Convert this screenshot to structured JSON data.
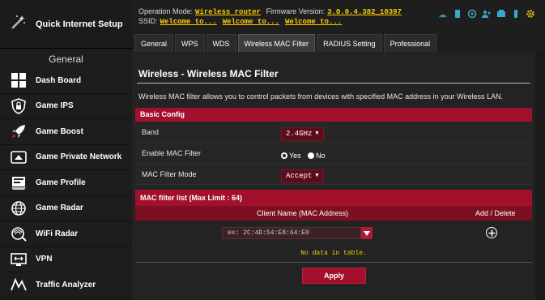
{
  "colors": {
    "accent": "#a2102b",
    "accent_dark": "#7c0f22",
    "value_yellow": "#ffcc00",
    "panel_bg": "#232323"
  },
  "sidebar": {
    "quick_setup": {
      "label": "Quick Internet Setup",
      "icon": "wizard-icon"
    },
    "section_label": "General",
    "items": [
      {
        "label": "Dash Board",
        "icon": "dashboard-icon"
      },
      {
        "label": "Game IPS",
        "icon": "lock-shield-icon"
      },
      {
        "label": "Game Boost",
        "icon": "rocket-icon"
      },
      {
        "label": "Game Private Network",
        "icon": "private-network-icon"
      },
      {
        "label": "Game Profile",
        "icon": "profile-icon"
      },
      {
        "label": "Game Radar",
        "icon": "radar-globe-icon"
      },
      {
        "label": "WiFi Radar",
        "icon": "wifi-radar-icon"
      },
      {
        "label": "VPN",
        "icon": "vpn-icon"
      },
      {
        "label": "Traffic Analyzer",
        "icon": "traffic-analyzer-icon"
      }
    ]
  },
  "status": {
    "op_mode_label": "Operation Mode:",
    "op_mode_value": "Wireless router",
    "firmware_label": "Firmware Version:",
    "firmware_value": "3.0.0.4.382_10397",
    "ssid_label": "SSID:",
    "ssid_values": [
      "Welcome to...",
      "Welcome to...",
      "Welcome to..."
    ]
  },
  "tabs": [
    {
      "label": "General",
      "active": false
    },
    {
      "label": "WPS",
      "active": false
    },
    {
      "label": "WDS",
      "active": false
    },
    {
      "label": "Wireless MAC Filter",
      "active": true
    },
    {
      "label": "RADIUS Setting",
      "active": false
    },
    {
      "label": "Professional",
      "active": false
    }
  ],
  "main": {
    "title": "Wireless - Wireless MAC Filter",
    "description": "Wireless MAC filter allows you to control packets from devices with specified MAC address in your Wireless LAN.",
    "basic_config": {
      "header": "Basic Config",
      "band_label": "Band",
      "band_value": "2.4GHz",
      "enable_label": "Enable MAC Filter",
      "enable_yes": "Yes",
      "enable_no": "No",
      "enable_selected": "Yes",
      "mode_label": "MAC Filter Mode",
      "mode_value": "Accept"
    },
    "mac_list": {
      "header": "MAC filter list (Max Limit : 64)",
      "col_client": "Client Name (MAC Address)",
      "col_action": "Add / Delete",
      "input_placeholder": "ex: 2C:4D:54:E8:64:E0",
      "empty_text": "No data in table."
    },
    "apply_label": "Apply"
  }
}
